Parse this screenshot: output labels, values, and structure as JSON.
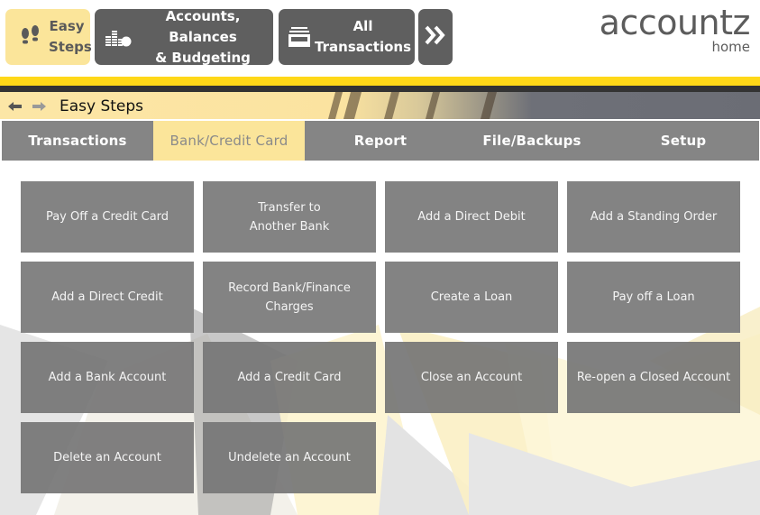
{
  "toolbar": {
    "easy_steps": {
      "line1": "Easy",
      "line2": "Steps",
      "icon": "footsteps-icon"
    },
    "accounts": {
      "line1": "Accounts, Balances",
      "line2": "& Budgeting",
      "icon": "coins-chart-icon"
    },
    "all_transactions": {
      "line1": "All",
      "line2": "Transactions",
      "icon": "inbox-tray-icon"
    },
    "more": {
      "label": "»",
      "icon": "double-chevron-right-icon"
    }
  },
  "brand": {
    "name": "accountz",
    "subtitle": "home"
  },
  "breadcrumb": {
    "back_icon": "arrow-left-icon",
    "forward_icon": "arrow-right-icon",
    "title": "Easy Steps"
  },
  "tabs": [
    {
      "label": "Transactions",
      "active": false
    },
    {
      "label": "Bank/Credit Card",
      "active": true
    },
    {
      "label": "Report",
      "active": false
    },
    {
      "label": "File/Backups",
      "active": false
    },
    {
      "label": "Setup",
      "active": false
    }
  ],
  "actions": [
    {
      "label": "Pay Off a Credit Card"
    },
    {
      "label": "Transfer to\nAnother Bank"
    },
    {
      "label": "Add a Direct Debit"
    },
    {
      "label": "Add a Standing Order"
    },
    {
      "label": "Add a Direct Credit"
    },
    {
      "label": "Record Bank/Finance\nCharges"
    },
    {
      "label": "Create a Loan"
    },
    {
      "label": "Pay off a Loan"
    },
    {
      "label": "Add a Bank Account"
    },
    {
      "label": "Add a Credit Card"
    },
    {
      "label": "Close an Account"
    },
    {
      "label": "Re-open a Closed Account"
    },
    {
      "label": "Delete an Account"
    },
    {
      "label": "Undelete an Account"
    }
  ],
  "colors": {
    "accent_yellow": "#ffd818",
    "active_tab": "#fbe59a",
    "toolbar_button": "#5f5f5f",
    "tab_bar": "#858585",
    "action_button": "#838383"
  }
}
